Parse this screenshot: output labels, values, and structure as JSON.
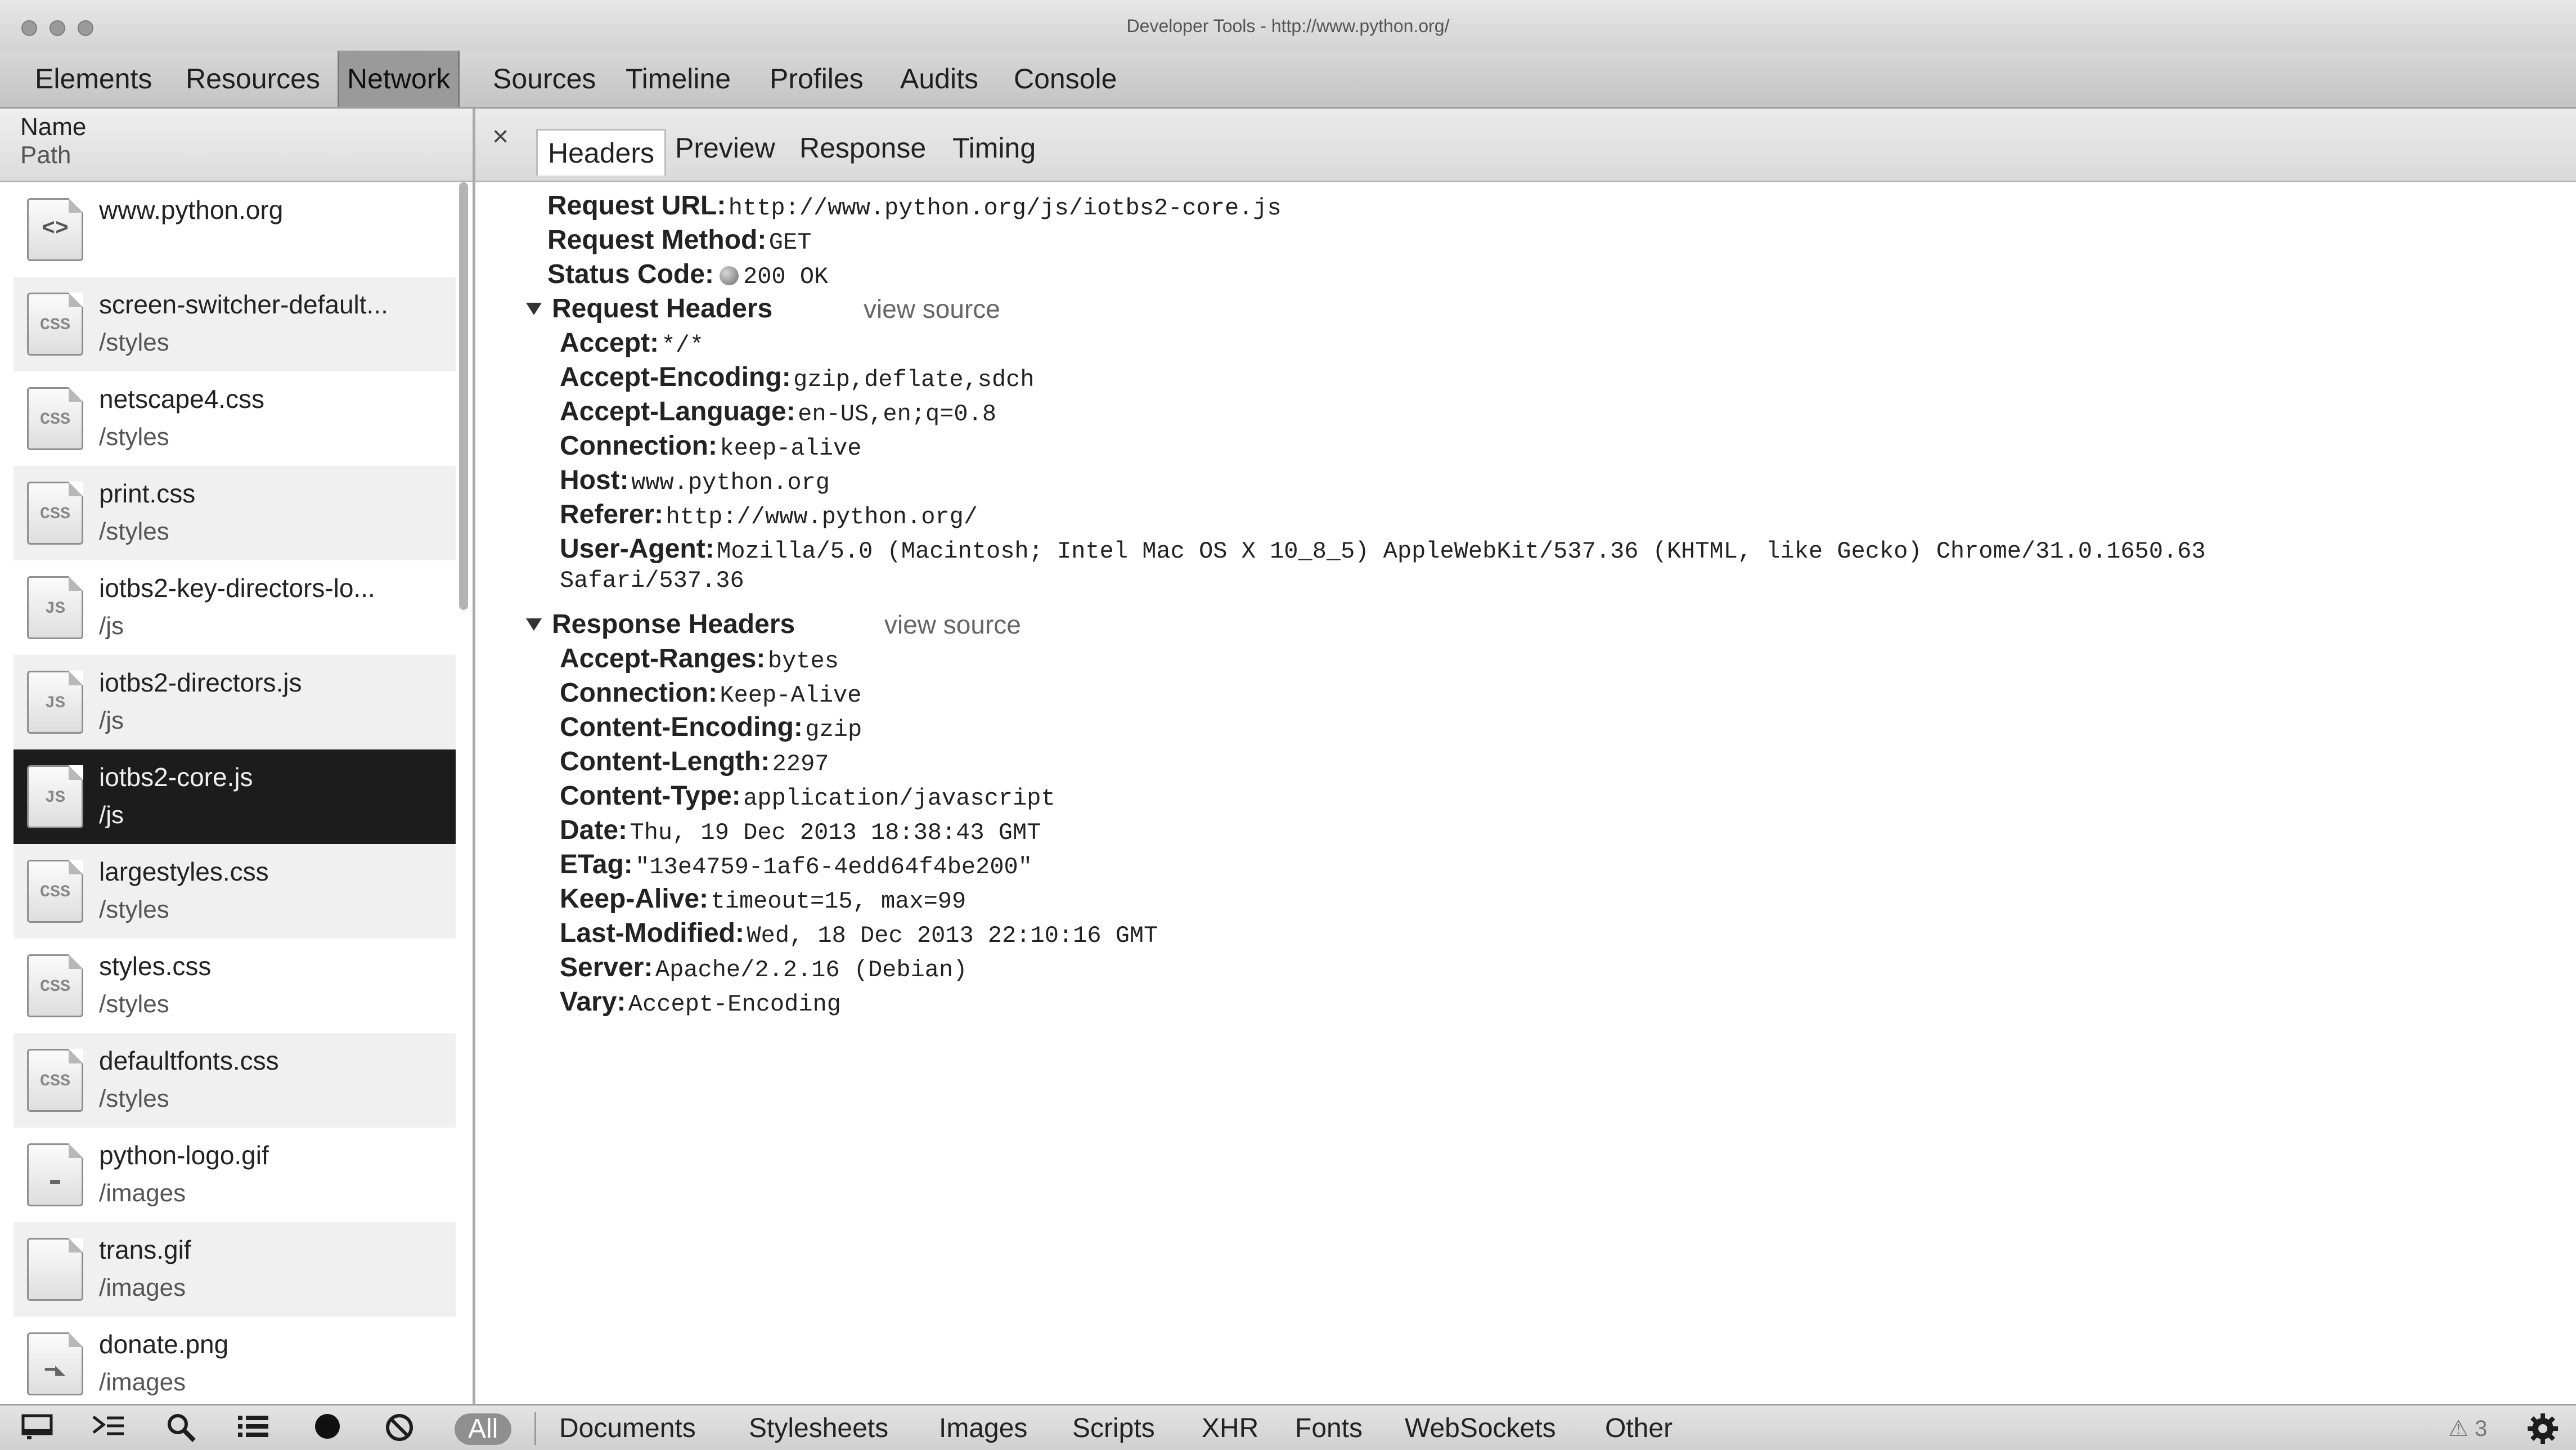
{
  "window": {
    "title": "Developer Tools - http://www.python.org/"
  },
  "main_tabs": [
    "Elements",
    "Resources",
    "Network",
    "Sources",
    "Timeline",
    "Profiles",
    "Audits",
    "Console"
  ],
  "active_main_tab": "Network",
  "sidebar": {
    "header_name": "Name",
    "header_path": "Path",
    "files": [
      {
        "name": "www.python.org",
        "path": "",
        "icon": "html-file-icon",
        "icon_label": "<>"
      },
      {
        "name": "screen-switcher-default...",
        "path": "/styles",
        "icon": "css-file-icon",
        "icon_label": "CSS"
      },
      {
        "name": "netscape4.css",
        "path": "/styles",
        "icon": "css-file-icon",
        "icon_label": "CSS"
      },
      {
        "name": "print.css",
        "path": "/styles",
        "icon": "css-file-icon",
        "icon_label": "CSS"
      },
      {
        "name": "iotbs2-key-directors-lo...",
        "path": "/js",
        "icon": "js-file-icon",
        "icon_label": "JS"
      },
      {
        "name": "iotbs2-directors.js",
        "path": "/js",
        "icon": "js-file-icon",
        "icon_label": "JS"
      },
      {
        "name": "iotbs2-core.js",
        "path": "/js",
        "icon": "js-file-icon",
        "icon_label": "JS"
      },
      {
        "name": "largestyles.css",
        "path": "/styles",
        "icon": "css-file-icon",
        "icon_label": "CSS"
      },
      {
        "name": "styles.css",
        "path": "/styles",
        "icon": "css-file-icon",
        "icon_label": "CSS"
      },
      {
        "name": "defaultfonts.css",
        "path": "/styles",
        "icon": "css-file-icon",
        "icon_label": "CSS"
      },
      {
        "name": "python-logo.gif",
        "path": "/images",
        "icon": "image-file-icon",
        "icon_label": "▬"
      },
      {
        "name": "trans.gif",
        "path": "/images",
        "icon": "image-file-icon",
        "icon_label": ""
      },
      {
        "name": "donate.png",
        "path": "/images",
        "icon": "image-file-icon",
        "icon_label": "━◣"
      }
    ],
    "selected_file": "iotbs2-core.js"
  },
  "detail": {
    "close_label": "×",
    "tabs": [
      "Headers",
      "Preview",
      "Response",
      "Timing"
    ],
    "active_tab": "Headers",
    "general": [
      {
        "key": "Request URL:",
        "value": "http://www.python.org/js/iotbs2-core.js"
      },
      {
        "key": "Request Method:",
        "value": "GET"
      },
      {
        "key": "Status Code:",
        "value": "200 OK"
      }
    ],
    "request_headers_title": "Request Headers",
    "request_view_source": "view source",
    "request_headers": [
      {
        "key": "Accept:",
        "value": "*/*"
      },
      {
        "key": "Accept-Encoding:",
        "value": "gzip,deflate,sdch"
      },
      {
        "key": "Accept-Language:",
        "value": "en-US,en;q=0.8"
      },
      {
        "key": "Connection:",
        "value": "keep-alive"
      },
      {
        "key": "Host:",
        "value": "www.python.org"
      },
      {
        "key": "Referer:",
        "value": "http://www.python.org/"
      },
      {
        "key": "User-Agent:",
        "value": "Mozilla/5.0 (Macintosh; Intel Mac OS X 10_8_5) AppleWebKit/537.36 (KHTML, like Gecko) Chrome/31.0.1650.63"
      }
    ],
    "user_agent_continuation": "Safari/537.36",
    "response_headers_title": "Response Headers",
    "response_view_source": "view source",
    "response_headers": [
      {
        "key": "Accept-Ranges:",
        "value": "bytes"
      },
      {
        "key": "Connection:",
        "value": "Keep-Alive"
      },
      {
        "key": "Content-Encoding:",
        "value": "gzip"
      },
      {
        "key": "Content-Length:",
        "value": "2297"
      },
      {
        "key": "Content-Type:",
        "value": "application/javascript"
      },
      {
        "key": "Date:",
        "value": "Thu, 19 Dec 2013 18:38:43 GMT"
      },
      {
        "key": "ETag:",
        "value": "\"13e4759-1af6-4edd64f4be200\""
      },
      {
        "key": "Keep-Alive:",
        "value": "timeout=15, max=99"
      },
      {
        "key": "Last-Modified:",
        "value": "Wed, 18 Dec 2013 22:10:16 GMT"
      },
      {
        "key": "Server:",
        "value": "Apache/2.2.16 (Debian)"
      },
      {
        "key": "Vary:",
        "value": "Accept-Encoding"
      }
    ]
  },
  "bottom_bar": {
    "icons": [
      "dock-icon",
      "console-prompt-icon",
      "search-icon",
      "list-icon",
      "record-icon",
      "clear-icon"
    ],
    "filters": [
      "All",
      "Documents",
      "Stylesheets",
      "Images",
      "Scripts",
      "XHR",
      "Fonts",
      "WebSockets",
      "Other"
    ],
    "active_filter": "All",
    "warning_count": "3"
  }
}
